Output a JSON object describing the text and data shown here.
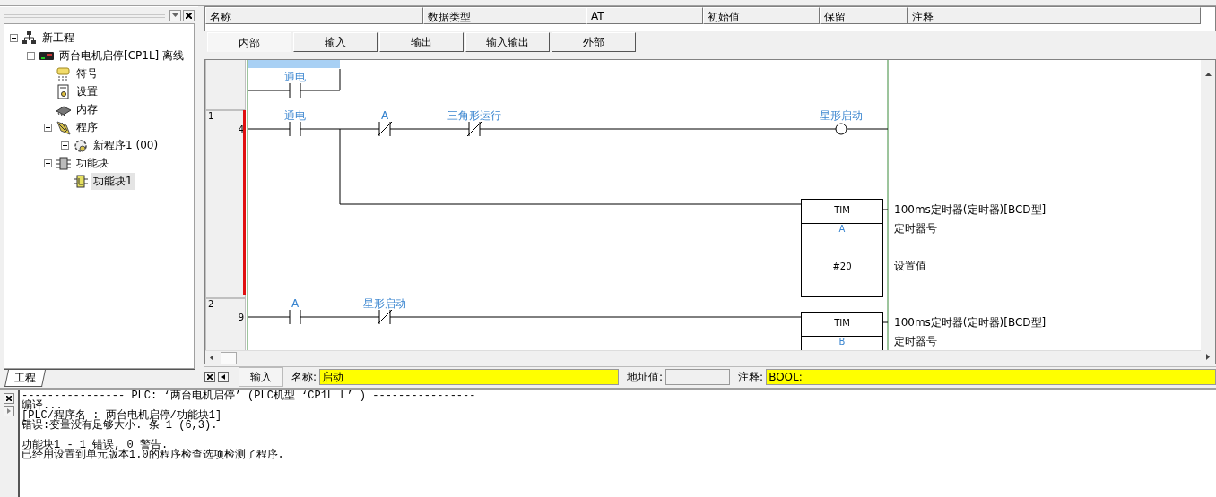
{
  "project_panel": {
    "tree": [
      {
        "label": "新工程",
        "kind": "project",
        "expanded": true,
        "selected": false,
        "children": [
          {
            "label": "两台电机启停[CP1L] 离线",
            "kind": "plc",
            "expanded": true,
            "selected": false,
            "children": [
              {
                "label": "符号",
                "kind": "symbols",
                "selected": false
              },
              {
                "label": "设置",
                "kind": "settings",
                "selected": false
              },
              {
                "label": "内存",
                "kind": "memory",
                "selected": false
              },
              {
                "label": "程序",
                "kind": "programs",
                "expanded": true,
                "selected": false,
                "children": [
                  {
                    "label": "新程序1 (00)",
                    "kind": "task",
                    "expanded": false,
                    "selected": false
                  }
                ]
              },
              {
                "label": "功能块",
                "kind": "function-blocks",
                "expanded": true,
                "selected": false,
                "children": [
                  {
                    "label": "功能块1",
                    "kind": "function-block",
                    "selected": true
                  }
                ]
              }
            ]
          }
        ]
      }
    ],
    "tab": "工程"
  },
  "variable_table": {
    "columns": [
      "名称",
      "数据类型",
      "AT",
      "初始值",
      "保留",
      "注释"
    ]
  },
  "variable_tabs": [
    {
      "label": "内部",
      "selected": true
    },
    {
      "label": "输入",
      "selected": false
    },
    {
      "label": "输出",
      "selected": false
    },
    {
      "label": "输入输出",
      "selected": false
    },
    {
      "label": "外部",
      "selected": false
    }
  ],
  "ladder": {
    "partial_rung": {
      "contacts": [
        {
          "kind": "no",
          "label": "通电"
        }
      ]
    },
    "rungs": [
      {
        "number": "1",
        "step": "4",
        "error": true,
        "contacts": [
          {
            "kind": "no",
            "label": "通电"
          },
          {
            "kind": "nc",
            "label": "A"
          },
          {
            "kind": "nc",
            "label": "三角形运行"
          }
        ],
        "output": {
          "kind": "coil",
          "label": "星形启动"
        },
        "branch": {
          "output": {
            "kind": "timer",
            "instruction": "TIM",
            "operands": [
              "A",
              "#20"
            ],
            "descriptions": [
              "100ms定时器(定时器)[BCD型]",
              "定时器号",
              "设置值"
            ]
          }
        }
      },
      {
        "number": "2",
        "step": "9",
        "error": false,
        "contacts": [
          {
            "kind": "no",
            "label": "A"
          },
          {
            "kind": "nc",
            "label": "星形启动"
          }
        ],
        "output": {
          "kind": "timer",
          "instruction": "TIM",
          "operands": [
            "B"
          ],
          "descriptions": [
            "100ms定时器(定时器)[BCD型]",
            "定时器号"
          ]
        }
      }
    ]
  },
  "name_bar": {
    "mode_button": "输入",
    "name_label": "名称:",
    "name_value": "启动",
    "address_label": "地址值:",
    "comment_label": "注释:",
    "comment_value": "BOOL:"
  },
  "output": {
    "paragraphs": [
      [
        "---------------- PLC: ‘两台电机启停’ (PLC机型 ‘CP1L L’ ) ----------------",
        "编译...",
        "[PLC/程序名 : 两台电机启停/功能块1]",
        "错误:变量没有足够大小. 条 1 (6,3)."
      ],
      [
        "功能块1 - 1 错误, 0 警告.",
        "已经用设置到单元版本1.0的程序检查选项检测了程序."
      ]
    ]
  }
}
